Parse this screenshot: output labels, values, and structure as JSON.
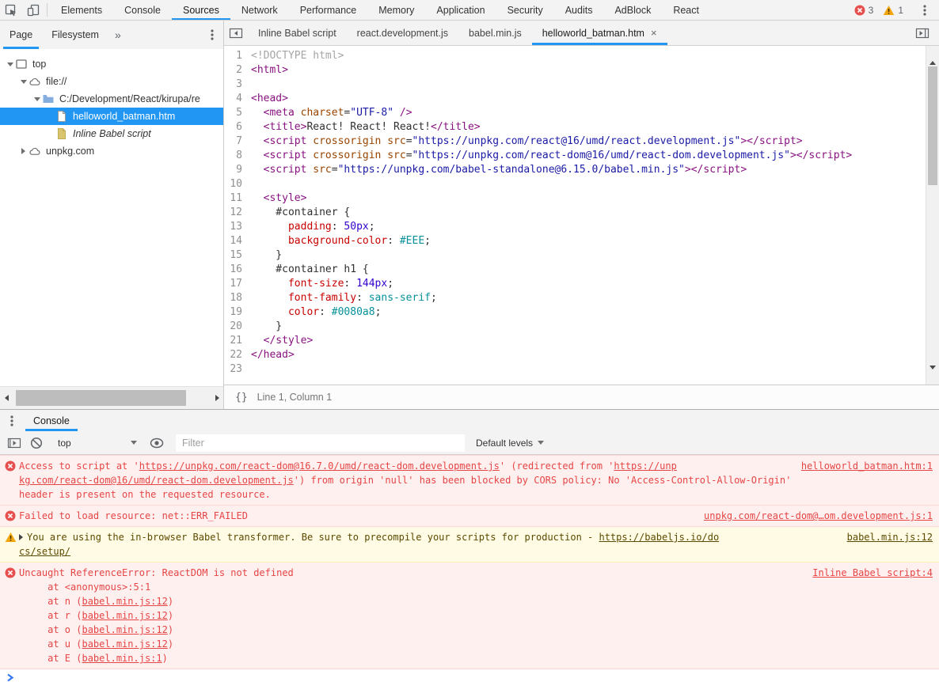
{
  "colors": {
    "accent": "#2196f3",
    "error_text": "#e64545",
    "error_bg": "#fff0f0",
    "warning_text": "#5c4a00",
    "warning_bg": "#fffbe4",
    "syntax_tag": "#881280",
    "syntax_attr": "#994500",
    "syntax_string": "#1a1aa6",
    "syntax_css_property": "#c80000",
    "syntax_css_number": "#3200cd",
    "syntax_css_value": "#07919a",
    "folder_icon": "#85aede",
    "script_file_icon": "#d9c470"
  },
  "toolbar": {
    "tabs": [
      {
        "label": "Elements",
        "active": false
      },
      {
        "label": "Console",
        "active": false
      },
      {
        "label": "Sources",
        "active": true
      },
      {
        "label": "Network",
        "active": false
      },
      {
        "label": "Performance",
        "active": false
      },
      {
        "label": "Memory",
        "active": false
      },
      {
        "label": "Application",
        "active": false
      },
      {
        "label": "Security",
        "active": false
      },
      {
        "label": "Audits",
        "active": false
      },
      {
        "label": "AdBlock",
        "active": false
      },
      {
        "label": "React",
        "active": false
      }
    ],
    "error_count": "3",
    "warning_count": "1"
  },
  "sidebar": {
    "tabs": [
      {
        "label": "Page",
        "active": true
      },
      {
        "label": "Filesystem",
        "active": false
      }
    ],
    "more_label": "»",
    "tree": [
      {
        "label": "top",
        "icon": "frame",
        "twisty": "open",
        "depth": 0,
        "selected": false,
        "italic": false
      },
      {
        "label": "file://",
        "icon": "cloud",
        "twisty": "open",
        "depth": 1,
        "selected": false,
        "italic": false
      },
      {
        "label": "C:/Development/React/kirupa/re",
        "icon": "folder",
        "twisty": "open",
        "depth": 2,
        "selected": false,
        "italic": false
      },
      {
        "label": "helloworld_batman.htm",
        "icon": "file",
        "twisty": "none",
        "depth": 3,
        "selected": true,
        "italic": false
      },
      {
        "label": "Inline Babel script",
        "icon": "script-file",
        "twisty": "none",
        "depth": 3,
        "selected": false,
        "italic": true
      },
      {
        "label": "unpkg.com",
        "icon": "cloud",
        "twisty": "closed",
        "depth": 1,
        "selected": false,
        "italic": false
      }
    ]
  },
  "editor": {
    "tabs": [
      {
        "label": "Inline Babel script",
        "active": false,
        "closable": false
      },
      {
        "label": "react.development.js",
        "active": false,
        "closable": false
      },
      {
        "label": "babel.min.js",
        "active": false,
        "closable": false
      },
      {
        "label": "helloworld_batman.htm",
        "active": true,
        "closable": true
      }
    ],
    "close_glyph": "×",
    "pretty_print_label": "{}",
    "status": "Line 1, Column 1",
    "code_lines": [
      {
        "n": "1",
        "segments": [
          [
            "com",
            "<!DOCTYPE html>"
          ]
        ]
      },
      {
        "n": "2",
        "segments": [
          [
            "tag",
            "<html>"
          ]
        ]
      },
      {
        "n": "3",
        "segments": []
      },
      {
        "n": "4",
        "segments": [
          [
            "tag",
            "<head>"
          ]
        ]
      },
      {
        "n": "5",
        "segments": [
          [
            "plain",
            "  "
          ],
          [
            "tag",
            "<meta "
          ],
          [
            "attr",
            "charset"
          ],
          [
            "plain",
            "="
          ],
          [
            "str",
            "\"UTF-8\""
          ],
          [
            "tag",
            " />"
          ]
        ]
      },
      {
        "n": "6",
        "segments": [
          [
            "plain",
            "  "
          ],
          [
            "tag",
            "<title>"
          ],
          [
            "plain",
            "React! React! React!"
          ],
          [
            "tag",
            "</title>"
          ]
        ]
      },
      {
        "n": "7",
        "segments": [
          [
            "plain",
            "  "
          ],
          [
            "tag",
            "<script "
          ],
          [
            "attr",
            "crossorigin "
          ],
          [
            "attr",
            "src"
          ],
          [
            "plain",
            "="
          ],
          [
            "str",
            "\"https://unpkg.com/react@16/umd/react.development.js\""
          ],
          [
            "tag",
            "></script>"
          ]
        ]
      },
      {
        "n": "8",
        "segments": [
          [
            "plain",
            "  "
          ],
          [
            "tag",
            "<script "
          ],
          [
            "attr",
            "crossorigin "
          ],
          [
            "attr",
            "src"
          ],
          [
            "plain",
            "="
          ],
          [
            "str",
            "\"https://unpkg.com/react-dom@16/umd/react-dom.development.js\""
          ],
          [
            "tag",
            "></script>"
          ]
        ]
      },
      {
        "n": "9",
        "segments": [
          [
            "plain",
            "  "
          ],
          [
            "tag",
            "<script "
          ],
          [
            "attr",
            "src"
          ],
          [
            "plain",
            "="
          ],
          [
            "str",
            "\"https://unpkg.com/babel-standalone@6.15.0/babel.min.js\""
          ],
          [
            "tag",
            "></script>"
          ]
        ]
      },
      {
        "n": "10",
        "segments": []
      },
      {
        "n": "11",
        "segments": [
          [
            "plain",
            "  "
          ],
          [
            "tag",
            "<style>"
          ]
        ]
      },
      {
        "n": "12",
        "segments": [
          [
            "plain",
            "    #container {"
          ]
        ]
      },
      {
        "n": "13",
        "segments": [
          [
            "plain",
            "      "
          ],
          [
            "prop",
            "padding"
          ],
          [
            "plain",
            ": "
          ],
          [
            "num",
            "50px"
          ],
          [
            "plain",
            ";"
          ]
        ]
      },
      {
        "n": "14",
        "segments": [
          [
            "plain",
            "      "
          ],
          [
            "prop",
            "background-color"
          ],
          [
            "plain",
            ": "
          ],
          [
            "val",
            "#EEE"
          ],
          [
            "plain",
            ";"
          ]
        ]
      },
      {
        "n": "15",
        "segments": [
          [
            "plain",
            "    }"
          ]
        ]
      },
      {
        "n": "16",
        "segments": [
          [
            "plain",
            "    #container h1 {"
          ]
        ]
      },
      {
        "n": "17",
        "segments": [
          [
            "plain",
            "      "
          ],
          [
            "prop",
            "font-size"
          ],
          [
            "plain",
            ": "
          ],
          [
            "num",
            "144px"
          ],
          [
            "plain",
            ";"
          ]
        ]
      },
      {
        "n": "18",
        "segments": [
          [
            "plain",
            "      "
          ],
          [
            "prop",
            "font-family"
          ],
          [
            "plain",
            ": "
          ],
          [
            "val",
            "sans-serif"
          ],
          [
            "plain",
            ";"
          ]
        ]
      },
      {
        "n": "19",
        "segments": [
          [
            "plain",
            "      "
          ],
          [
            "prop",
            "color"
          ],
          [
            "plain",
            ": "
          ],
          [
            "val",
            "#0080a8"
          ],
          [
            "plain",
            ";"
          ]
        ]
      },
      {
        "n": "20",
        "segments": [
          [
            "plain",
            "    }"
          ]
        ]
      },
      {
        "n": "21",
        "segments": [
          [
            "plain",
            "  "
          ],
          [
            "tag",
            "</style>"
          ]
        ]
      },
      {
        "n": "22",
        "segments": [
          [
            "tag",
            "</head>"
          ]
        ]
      },
      {
        "n": "23",
        "segments": []
      }
    ]
  },
  "console": {
    "tab_label": "Console",
    "context": "top",
    "filter_placeholder": "Filter",
    "levels_label": "Default levels",
    "messages": [
      {
        "type": "error",
        "source_link": "helloworld_batman.htm:1",
        "expandable": false,
        "lines": [
          [
            {
              "t": "Access to script at '"
            },
            {
              "t": "https://unpkg.com/react-dom@16.7.0/umd/react-dom.development.js",
              "u": true
            },
            {
              "t": "' (redirected from '"
            },
            {
              "t": "https://unp",
              "u": true
            }
          ],
          [
            {
              "t": "kg.com/react-dom@16/umd/react-dom.development.js",
              "u": true
            },
            {
              "t": "') from origin 'null' has been blocked by CORS policy: No 'Access-Control-Allow-Origin'"
            }
          ],
          [
            {
              "t": "header is present on the requested resource."
            }
          ]
        ]
      },
      {
        "type": "error",
        "source_link": "unpkg.com/react-dom@…om.development.js:1",
        "expandable": false,
        "lines": [
          [
            {
              "t": "Failed to load resource: net::ERR_FAILED"
            }
          ]
        ]
      },
      {
        "type": "warning",
        "source_link": "babel.min.js:12",
        "expandable": true,
        "lines": [
          [
            {
              "t": "You are using the in-browser Babel transformer. Be sure to precompile your scripts for production - "
            },
            {
              "t": "https://babeljs.io/do",
              "u": true
            }
          ],
          [
            {
              "t": "cs/setup/",
              "u": true
            }
          ]
        ]
      },
      {
        "type": "error",
        "source_link": "Inline Babel script:4",
        "expandable": false,
        "lines": [
          [
            {
              "t": "Uncaught ReferenceError: ReactDOM is not defined"
            }
          ],
          [
            {
              "t": "     at <anonymous>:5:1"
            }
          ],
          [
            {
              "t": "     at n ("
            },
            {
              "t": "babel.min.js:12",
              "u": true
            },
            {
              "t": ")"
            }
          ],
          [
            {
              "t": "     at r ("
            },
            {
              "t": "babel.min.js:12",
              "u": true
            },
            {
              "t": ")"
            }
          ],
          [
            {
              "t": "     at o ("
            },
            {
              "t": "babel.min.js:12",
              "u": true
            },
            {
              "t": ")"
            }
          ],
          [
            {
              "t": "     at u ("
            },
            {
              "t": "babel.min.js:12",
              "u": true
            },
            {
              "t": ")"
            }
          ],
          [
            {
              "t": "     at E ("
            },
            {
              "t": "babel.min.js:1",
              "u": true
            },
            {
              "t": ")"
            }
          ]
        ]
      }
    ]
  }
}
